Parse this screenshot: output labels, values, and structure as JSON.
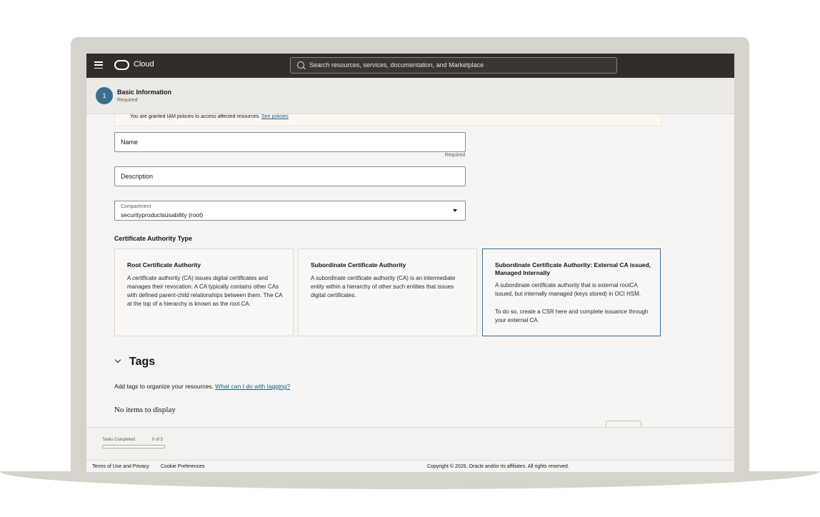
{
  "header": {
    "brand": "Cloud",
    "search_placeholder": "Search resources, services, documentation, and Marketplace"
  },
  "wizard": {
    "step_number": "1",
    "step_title": "Basic Information",
    "step_status": "Required"
  },
  "notice": {
    "text": "You are granted IAM policies to access affected resources.",
    "link": "See policies"
  },
  "form": {
    "name_placeholder": "Name",
    "name_required": "Required",
    "description_placeholder": "Description",
    "compartment_label": "Compartment",
    "compartment_value": "securityproductsusability (root)",
    "ca_type_label": "Certificate Authority Type"
  },
  "ca_types": [
    {
      "title": "Root Certificate Authority",
      "description": "A certificate authority (CA) issues digital certificates and manages their revocation. A CA typically contains other CAs with defined parent-child relationships between them. The CA at the top of a hierarchy is known as the root CA.",
      "selected": false
    },
    {
      "title": "Subordinate Certificate Authority",
      "description": "A subordinate certificate authority (CA) is an intermediate entity within a hierarchy of other such entities that issues digital certificates.",
      "selected": false
    },
    {
      "title": "Subordinate Certificate Authority: External CA issued, Managed Internally",
      "description": "A subordinate certificate authority that is external rootCA issued, but internally managed (keys stored) in OCI HSM.",
      "description2": "To do so, create a CSR here and complete issuance through your external CA.",
      "selected": true
    }
  ],
  "tags": {
    "title": "Tags",
    "description": "Add tags to organize your resources.",
    "link": "What can I do with tagging?",
    "empty": "No items to display"
  },
  "tasks": {
    "label": "Tasks Completed",
    "count": "0 of 5",
    "progress": 0
  },
  "footer": {
    "terms": "Terms of Use and Privacy",
    "cookies": "Cookie Preferences",
    "copyright": "Copyright © 2026, Oracle and/or its affiliates. All rights reserved."
  },
  "colors": {
    "accent": "#3b6e8f",
    "topbar": "#312d2a",
    "link": "#1e5a86"
  }
}
